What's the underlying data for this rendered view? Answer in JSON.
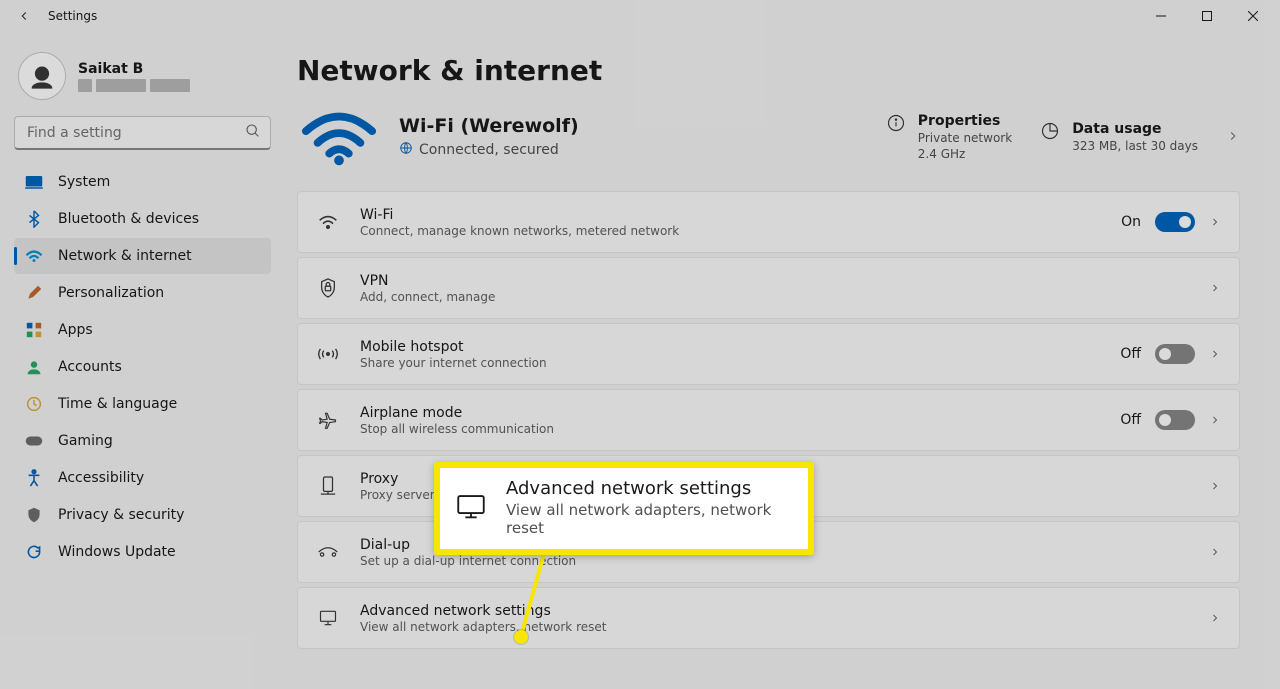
{
  "window": {
    "title": "Settings"
  },
  "account": {
    "name": "Saikat B"
  },
  "search": {
    "placeholder": "Find a setting"
  },
  "sidebar": {
    "items": [
      {
        "label": "System",
        "icon": "system-icon",
        "color": "#0067c0"
      },
      {
        "label": "Bluetooth & devices",
        "icon": "bluetooth-icon",
        "color": "#0067c0"
      },
      {
        "label": "Network & internet",
        "icon": "network-icon",
        "color": "#0095d8",
        "active": true
      },
      {
        "label": "Personalization",
        "icon": "personalization-icon",
        "color": "#c36b2d"
      },
      {
        "label": "Apps",
        "icon": "apps-icon",
        "color": "#0067c0"
      },
      {
        "label": "Accounts",
        "icon": "accounts-icon",
        "color": "#2aa862"
      },
      {
        "label": "Time & language",
        "icon": "time-language-icon",
        "color": "#e0a93e"
      },
      {
        "label": "Gaming",
        "icon": "gaming-icon",
        "color": "#6e6e6e"
      },
      {
        "label": "Accessibility",
        "icon": "accessibility-icon",
        "color": "#0067c0"
      },
      {
        "label": "Privacy & security",
        "icon": "privacy-icon",
        "color": "#6e6e6e"
      },
      {
        "label": "Windows Update",
        "icon": "windows-update-icon",
        "color": "#0067c0"
      }
    ]
  },
  "page": {
    "title": "Network & internet"
  },
  "status": {
    "ssid": "Wi-Fi (Werewolf)",
    "state": "Connected, secured",
    "properties_label": "Properties",
    "properties_line1": "Private network",
    "properties_line2": "2.4 GHz",
    "usage_label": "Data usage",
    "usage_line": "323 MB, last 30 days"
  },
  "rows": [
    {
      "icon": "wifi-icon",
      "title": "Wi-Fi",
      "sub": "Connect, manage known networks, metered network",
      "toggle": "On"
    },
    {
      "icon": "vpn-icon",
      "title": "VPN",
      "sub": "Add, connect, manage"
    },
    {
      "icon": "hotspot-icon",
      "title": "Mobile hotspot",
      "sub": "Share your internet connection",
      "toggle": "Off"
    },
    {
      "icon": "airplane-icon",
      "title": "Airplane mode",
      "sub": "Stop all wireless communication",
      "toggle": "Off"
    },
    {
      "icon": "proxy-icon",
      "title": "Proxy",
      "sub": "Proxy server for W"
    },
    {
      "icon": "dialup-icon",
      "title": "Dial-up",
      "sub": "Set up a dial-up internet connection"
    },
    {
      "icon": "monitor-icon",
      "title": "Advanced network settings",
      "sub": "View all network adapters, network reset"
    }
  ],
  "callout": {
    "title": "Advanced network settings",
    "sub": "View all network adapters, network reset"
  }
}
